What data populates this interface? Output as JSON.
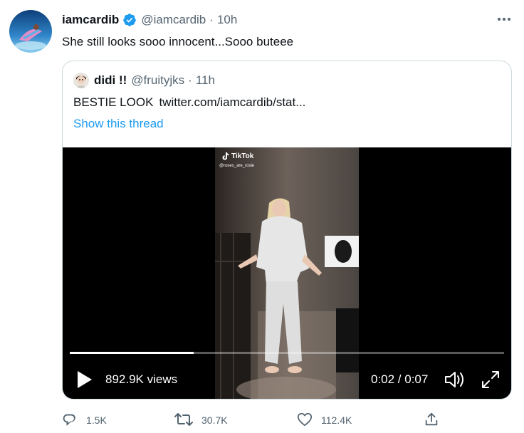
{
  "tweet": {
    "display_name": "iamcardib",
    "handle": "@iamcardib",
    "separator": "·",
    "time": "10h",
    "text": "She still looks sooo innocent...Sooo buteee",
    "verified_icon": "verified-badge-icon",
    "more_icon": "more-dots-icon"
  },
  "quote": {
    "display_name": "didi !!",
    "handle": "@fruityjks",
    "separator": "·",
    "time": "11h",
    "text": "BESTIE LOOK",
    "link": "twitter.com/iamcardib/stat...",
    "show_thread": "Show this thread"
  },
  "video": {
    "watermark": "TikTok",
    "watermark_user": "@roses_are_rosie",
    "views": "892.9K views",
    "duration": "0:02 / 0:07",
    "progress": 0.285,
    "icons": [
      "play-icon",
      "volume-icon",
      "fullscreen-icon"
    ]
  },
  "actions": {
    "reply_count": "1.5K",
    "retweet_count": "30.7K",
    "like_count": "112.4K"
  },
  "colors": {
    "accent": "#1d9bf0",
    "secondary_text": "#536471",
    "border": "#cfd9de"
  }
}
